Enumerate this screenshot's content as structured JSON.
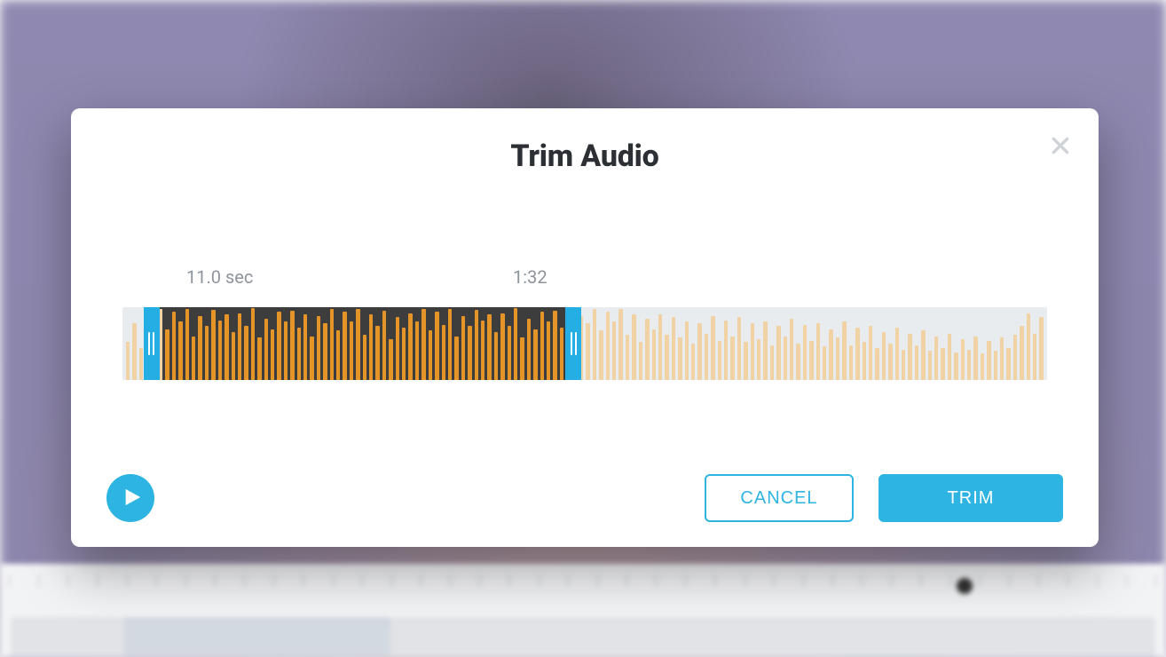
{
  "modal": {
    "title": "Trim Audio",
    "start_label": "11.0 sec",
    "end_label": "1:32",
    "cancel_label": "CANCEL",
    "trim_label": "TRIM",
    "selection": {
      "start_pct": 4.0,
      "end_pct": 47.9
    }
  },
  "colors": {
    "accent": "#2db4e2",
    "bar_selected": "#e59427",
    "bar_unselected": "#f0d2a5",
    "selected_bg": "#3d3d3d",
    "track_bg": "#e9ecef"
  },
  "waveform": {
    "bars": [
      52,
      78,
      44,
      62,
      88,
      97,
      70,
      94,
      80,
      98,
      60,
      88,
      75,
      96,
      82,
      90,
      66,
      92,
      74,
      99,
      58,
      84,
      70,
      94,
      80,
      95,
      72,
      90,
      60,
      88,
      78,
      97,
      68,
      94,
      80,
      98,
      62,
      90,
      74,
      95,
      56,
      86,
      72,
      92,
      80,
      97,
      68,
      94,
      76,
      98,
      60,
      88,
      74,
      96,
      82,
      90,
      66,
      92,
      74,
      99,
      58,
      84,
      70,
      94,
      80,
      95,
      72,
      90,
      60,
      88,
      78,
      97,
      68,
      94,
      80,
      98,
      62,
      90,
      52,
      84,
      70,
      90,
      62,
      86,
      58,
      80,
      50,
      78,
      64,
      88,
      54,
      82,
      60,
      86,
      52,
      78,
      56,
      80,
      48,
      74,
      60,
      84,
      50,
      76,
      54,
      78,
      46,
      70,
      58,
      80,
      48,
      72,
      52,
      74,
      44,
      66,
      50,
      72,
      42,
      64,
      48,
      68,
      40,
      60,
      44,
      64,
      38,
      56,
      42,
      60,
      36,
      54,
      40,
      58,
      44,
      62,
      74,
      92,
      64,
      86
    ]
  }
}
